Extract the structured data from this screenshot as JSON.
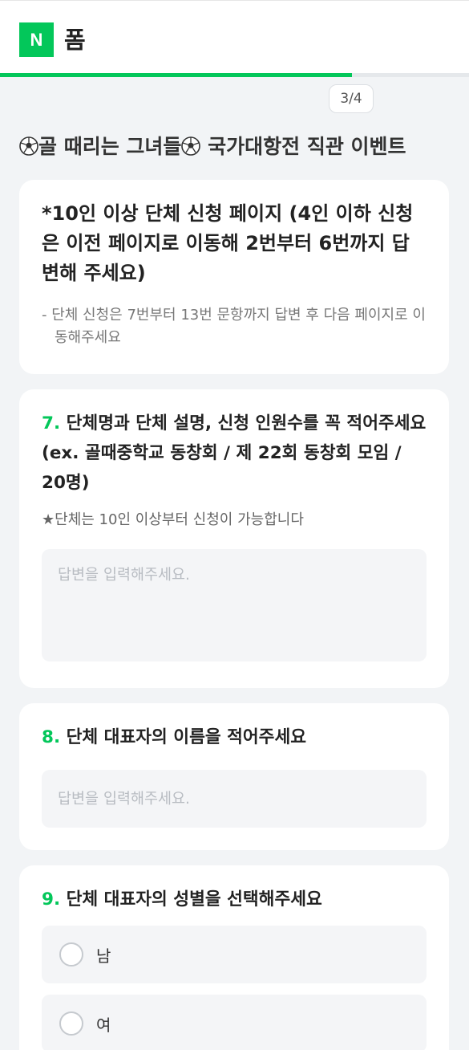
{
  "header": {
    "logo_letter": "N",
    "app_title": "폼",
    "progress_fraction": 0.75
  },
  "page_indicator": "3/4",
  "form_title_parts": [
    "골 때리는 그녀들",
    " 국가대항전 직관 이벤트"
  ],
  "form_title_icon": "soccer-ball-icon",
  "intro": {
    "heading": "*10인 이상 단체 신청 페이지  (4인 이하 신청은 이전 페이지로 이동해 2번부터 6번까지 답변해 주세요)",
    "note": "- 단체 신청은 7번부터 13번 문항까지 답변 후 다음 페이지로 이동해주세요"
  },
  "questions": [
    {
      "number": "7.",
      "title": "단체명과 단체 설명, 신청 인원수를 꼭 적어주세요 (ex. 골때중학교 동창회 / 제 22회 동창회 모임 / 20명)",
      "description": "★단체는 10인 이상부터 신청이 가능합니다",
      "placeholder": "답변을 입력해주세요."
    },
    {
      "number": "8.",
      "title": "단체 대표자의 이름을 적어주세요",
      "placeholder": "답변을 입력해주세요."
    },
    {
      "number": "9.",
      "title": "단체 대표자의 성별을 선택해주세요",
      "options": [
        "남",
        "여"
      ]
    }
  ],
  "colors": {
    "accent": "#03c75a",
    "background": "#f2f4f6"
  }
}
